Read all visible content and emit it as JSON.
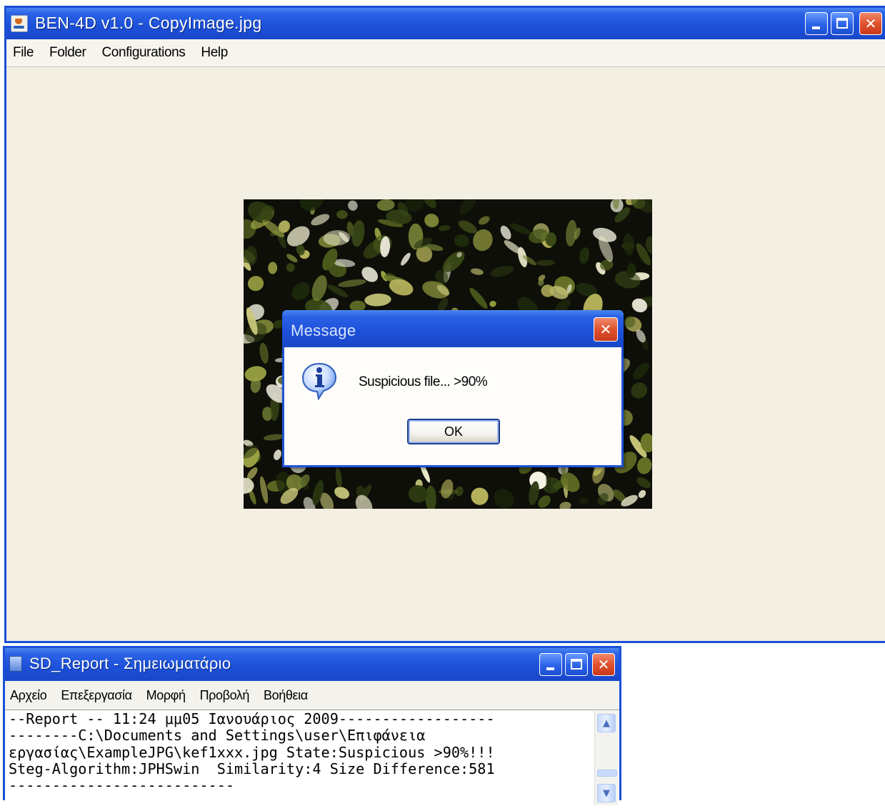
{
  "main_window": {
    "title": "BEN-4D v1.0 - CopyImage.jpg",
    "menu": [
      "File",
      "Folder",
      "Configurations",
      "Help"
    ],
    "controls": {
      "minimize": "minimize",
      "maximize": "maximize",
      "close": "✕"
    }
  },
  "message_dialog": {
    "title": "Message",
    "text": "Suspicious file... >90%",
    "ok_label": "OK",
    "close": "✕"
  },
  "notepad_window": {
    "title": "SD_Report - Σημειωματάριο",
    "menu": [
      "Αρχείο",
      "Επεξεργασία",
      "Μορφή",
      "Προβολή",
      "Βοήθεια"
    ],
    "controls": {
      "minimize": "minimize",
      "maximize": "maximize",
      "close": "✕"
    },
    "content_lines": [
      "--Report -- 11:24 μμ05 Ιανουάριος 2009------------------",
      "--------C:\\Documents and Settings\\user\\Επιφάνεια",
      "εργασίας\\ExampleJPG\\kef1xxx.jpg State:Suspicious >90%!!!",
      "Steg-Algorithm:JPHSwin  Similarity:4 Size Difference:581",
      "--------------------------"
    ]
  },
  "icons": [
    "java-app-icon",
    "notepad-icon",
    "information-icon",
    "scroll-up-icon",
    "scroll-down-icon"
  ],
  "colors": {
    "xp_title_blue": "#1c4fd8",
    "close_red": "#e0522e",
    "workspace_bg": "#f3efe3"
  }
}
